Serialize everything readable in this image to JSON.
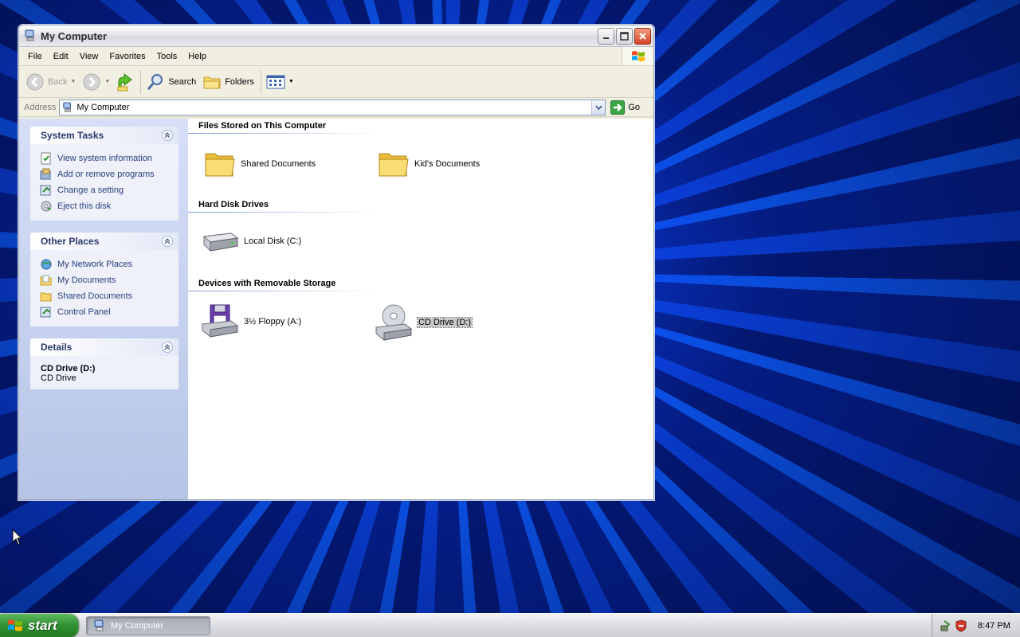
{
  "window": {
    "title": "My Computer"
  },
  "menu": [
    "File",
    "Edit",
    "View",
    "Favorites",
    "Tools",
    "Help"
  ],
  "toolbar": {
    "back_label": "Back",
    "search_label": "Search",
    "folders_label": "Folders"
  },
  "address": {
    "label": "Address",
    "value": "My Computer",
    "go_label": "Go"
  },
  "tasks": {
    "system_tasks": {
      "title": "System Tasks",
      "items": [
        "View system information",
        "Add or remove programs",
        "Change a setting",
        "Eject this disk"
      ]
    },
    "other_places": {
      "title": "Other Places",
      "items": [
        "My Network Places",
        "My Documents",
        "Shared Documents",
        "Control Panel"
      ]
    },
    "details": {
      "title": "Details",
      "name": "CD Drive (D:)",
      "type": "CD Drive"
    }
  },
  "groups": {
    "files": {
      "title": "Files Stored on This Computer",
      "items": [
        "Shared Documents",
        "Kid's Documents"
      ]
    },
    "hdd": {
      "title": "Hard Disk Drives",
      "items": [
        "Local Disk (C:)"
      ]
    },
    "removable": {
      "title": "Devices with Removable Storage",
      "items": [
        "3½ Floppy (A:)",
        "CD Drive (D:)"
      ]
    }
  },
  "taskbar": {
    "start_label": "start",
    "task_label": "My Computer",
    "clock": "8:47 PM"
  },
  "colors": {
    "link": "#2a3f7c",
    "start_green": "#2f8f2f",
    "selection": "#c8c8c8"
  }
}
